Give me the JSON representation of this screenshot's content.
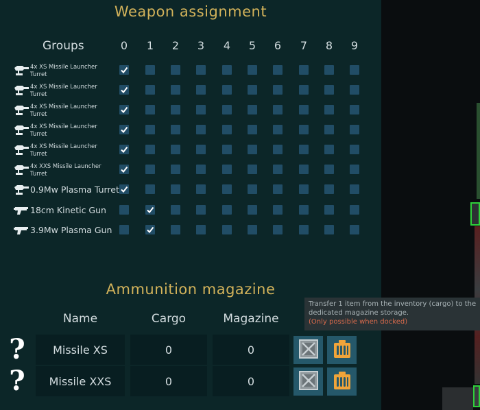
{
  "weapon_assignment": {
    "title": "Weapon assignment",
    "groups_label": "Groups",
    "group_numbers": [
      "0",
      "1",
      "2",
      "3",
      "4",
      "5",
      "6",
      "7",
      "8",
      "9"
    ],
    "weapons": [
      {
        "line1": "4x XS Missile Launcher",
        "line2": "Turret",
        "icon": "turret-icon",
        "checked": [
          0
        ]
      },
      {
        "line1": "4x XS Missile Launcher",
        "line2": "Turret",
        "icon": "turret-icon",
        "checked": [
          0
        ]
      },
      {
        "line1": "4x XS Missile Launcher",
        "line2": "Turret",
        "icon": "turret-icon",
        "checked": [
          0
        ]
      },
      {
        "line1": "4x XS Missile Launcher",
        "line2": "Turret",
        "icon": "turret-icon",
        "checked": [
          0
        ]
      },
      {
        "line1": "4x XS Missile Launcher",
        "line2": "Turret",
        "icon": "turret-icon",
        "checked": [
          0
        ]
      },
      {
        "line1": "4x XXS Missile Launcher",
        "line2": "Turret",
        "icon": "turret-icon",
        "checked": [
          0
        ]
      },
      {
        "label": "0.9Mw Plasma Turret",
        "icon": "turret-icon",
        "checked": [
          0
        ]
      },
      {
        "label": "18cm Kinetic Gun",
        "icon": "fixed-gun-icon",
        "checked": [
          1
        ]
      },
      {
        "label": "3.9Mw Plasma Gun",
        "icon": "fixed-gun-icon",
        "checked": [
          1
        ]
      }
    ]
  },
  "ammunition_magazine": {
    "title": "Ammunition magazine",
    "headers": {
      "name": "Name",
      "cargo": "Cargo",
      "magazine": "Magazine"
    },
    "rows": [
      {
        "icon": "unknown-item-icon",
        "name": "Missile XS",
        "cargo": "0",
        "magazine": "0"
      },
      {
        "icon": "unknown-item-icon",
        "name": "Missile XXS",
        "cargo": "0",
        "magazine": "0"
      }
    ]
  },
  "tooltip": {
    "line1": "Transfer 1 item from the inventory (cargo) to the",
    "line2": "dedicated magazine storage.",
    "warning": "(Only possible when docked)"
  },
  "colors": {
    "panel": "#0c2628",
    "title": "#d2b25a",
    "checkbox": "#214d66",
    "cell": "#081e21",
    "button": "#25586a",
    "ammo_icon": "#f0a43a",
    "warning": "#d86a4c"
  }
}
